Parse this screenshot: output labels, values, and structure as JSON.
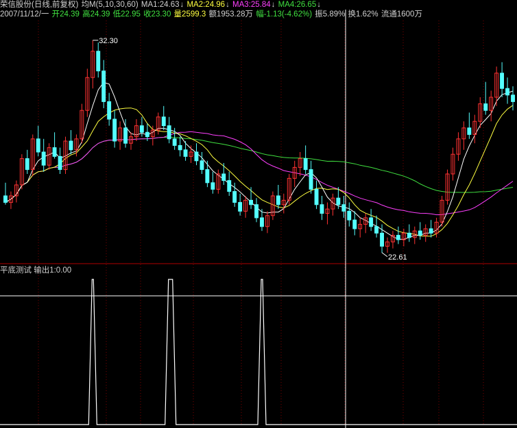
{
  "header": {
    "title": "荣信股份(日线,前复权)",
    "ma_label": "均M(5,10,30,60)",
    "ma1": "MA1:24.63",
    "ma2": "MA2:24.96",
    "ma3": "MA3:25.84",
    "ma4": "MA4:26.65",
    "arrow": "↓"
  },
  "quote": {
    "date": "2007/11/12/一",
    "open": "开24.39",
    "high": "高24.39",
    "low": "低22.95",
    "close": "收23.30",
    "volume": "量2599.3",
    "amount": "额1953.28万",
    "change": "幅-1.13(-4.62%)",
    "amplitude": "振5.89%",
    "turnover": "换1.62%",
    "float": "流通1600万"
  },
  "indicator": {
    "name": "平底测试",
    "output": "输出1:0.00"
  },
  "colors": {
    "up": "#ff3232",
    "down": "#54ffff",
    "ma1": "#ffffff",
    "ma2": "#ffff40",
    "ma3": "#ff40ff",
    "ma4": "#40e040",
    "divider": "#b00000",
    "grid": "#800000"
  },
  "chart_data": {
    "type": "candlestick",
    "price_range": [
      22.2,
      33.2
    ],
    "annotations": [
      {
        "label": "32.30",
        "value": 32.3,
        "kind": "high"
      },
      {
        "label": "22.61",
        "value": 22.61,
        "kind": "low"
      }
    ],
    "candles": [
      [
        25.2,
        25.8,
        24.8,
        24.9
      ],
      [
        24.9,
        25.4,
        24.6,
        25.2
      ],
      [
        25.2,
        25.9,
        24.9,
        25.7
      ],
      [
        25.7,
        27.1,
        25.5,
        26.9
      ],
      [
        26.9,
        27.3,
        26.2,
        26.4
      ],
      [
        26.4,
        28.0,
        26.1,
        27.8
      ],
      [
        27.8,
        28.4,
        27.0,
        27.2
      ],
      [
        27.2,
        27.8,
        26.3,
        26.6
      ],
      [
        26.6,
        27.6,
        26.4,
        27.4
      ],
      [
        27.4,
        28.1,
        26.9,
        27.0
      ],
      [
        27.0,
        27.4,
        26.2,
        26.4
      ],
      [
        26.4,
        27.9,
        26.2,
        27.7
      ],
      [
        27.7,
        28.2,
        27.1,
        27.3
      ],
      [
        27.3,
        28.0,
        27.0,
        27.8
      ],
      [
        27.8,
        29.4,
        27.6,
        29.1
      ],
      [
        29.1,
        31.0,
        28.8,
        30.6
      ],
      [
        30.6,
        32.3,
        30.1,
        31.8
      ],
      [
        31.8,
        32.2,
        30.6,
        30.9
      ],
      [
        30.9,
        31.4,
        29.2,
        29.5
      ],
      [
        29.5,
        29.9,
        28.4,
        28.7
      ],
      [
        28.7,
        29.1,
        27.4,
        27.7
      ],
      [
        27.7,
        28.6,
        27.3,
        28.3
      ],
      [
        28.3,
        28.7,
        27.4,
        27.6
      ],
      [
        27.6,
        28.1,
        27.3,
        27.9
      ],
      [
        27.9,
        28.7,
        27.7,
        28.4
      ],
      [
        28.4,
        28.8,
        27.9,
        28.1
      ],
      [
        28.1,
        28.5,
        27.7,
        27.9
      ],
      [
        27.9,
        28.4,
        27.5,
        28.2
      ],
      [
        28.2,
        29.0,
        28.0,
        28.8
      ],
      [
        28.8,
        29.3,
        28.2,
        28.4
      ],
      [
        28.4,
        28.8,
        27.6,
        27.8
      ],
      [
        27.8,
        28.3,
        27.3,
        27.5
      ],
      [
        27.5,
        27.9,
        27.0,
        27.3
      ],
      [
        27.3,
        27.7,
        26.8,
        27.0
      ],
      [
        27.0,
        27.5,
        26.7,
        27.2
      ],
      [
        27.2,
        27.6,
        26.6,
        26.8
      ],
      [
        26.8,
        27.2,
        26.2,
        26.4
      ],
      [
        26.4,
        26.8,
        25.6,
        25.8
      ],
      [
        25.8,
        26.3,
        25.3,
        25.5
      ],
      [
        25.5,
        26.4,
        25.3,
        26.2
      ],
      [
        26.2,
        26.7,
        25.7,
        25.9
      ],
      [
        25.9,
        26.3,
        25.2,
        25.4
      ],
      [
        25.4,
        25.8,
        24.7,
        24.9
      ],
      [
        24.9,
        25.3,
        24.3,
        24.5
      ],
      [
        24.5,
        25.2,
        24.2,
        25.0
      ],
      [
        25.0,
        25.6,
        24.6,
        24.8
      ],
      [
        24.8,
        25.1,
        24.0,
        24.2
      ],
      [
        24.2,
        24.6,
        23.6,
        23.8
      ],
      [
        23.8,
        24.5,
        23.5,
        24.3
      ],
      [
        24.3,
        25.4,
        24.1,
        25.2
      ],
      [
        25.2,
        25.7,
        24.6,
        24.8
      ],
      [
        24.8,
        25.3,
        24.4,
        25.0
      ],
      [
        25.0,
        26.2,
        24.8,
        26.0
      ],
      [
        26.0,
        26.8,
        25.6,
        26.5
      ],
      [
        26.5,
        27.2,
        26.1,
        26.9
      ],
      [
        26.9,
        27.5,
        26.2,
        26.4
      ],
      [
        26.4,
        26.8,
        25.3,
        25.5
      ],
      [
        25.5,
        25.9,
        24.6,
        24.8
      ],
      [
        24.8,
        25.2,
        24.1,
        24.4
      ],
      [
        24.4,
        24.9,
        23.9,
        24.6
      ],
      [
        24.6,
        25.3,
        24.3,
        25.1
      ],
      [
        25.1,
        25.6,
        24.6,
        24.8
      ],
      [
        24.8,
        25.2,
        24.2,
        24.5
      ],
      [
        24.5,
        24.9,
        23.8,
        24.1
      ],
      [
        24.1,
        24.5,
        23.4,
        23.7
      ],
      [
        23.7,
        24.2,
        23.3,
        23.9
      ],
      [
        23.9,
        24.4,
        23.5,
        24.2
      ],
      [
        24.2,
        24.6,
        23.6,
        23.8
      ],
      [
        23.8,
        24.3,
        23.3,
        23.5
      ],
      [
        23.5,
        23.9,
        22.6,
        22.9
      ],
      [
        22.9,
        23.3,
        22.6,
        23.1
      ],
      [
        23.1,
        23.6,
        22.8,
        23.4
      ],
      [
        23.4,
        23.8,
        23.0,
        23.2
      ],
      [
        23.2,
        23.7,
        22.9,
        23.5
      ],
      [
        23.5,
        23.9,
        23.1,
        23.3
      ],
      [
        23.3,
        23.8,
        23.0,
        23.6
      ],
      [
        23.6,
        24.0,
        23.2,
        23.4
      ],
      [
        23.4,
        23.9,
        23.1,
        23.7
      ],
      [
        23.7,
        24.1,
        23.3,
        23.5
      ],
      [
        23.5,
        24.2,
        23.3,
        24.0
      ],
      [
        24.0,
        25.2,
        23.8,
        25.0
      ],
      [
        25.0,
        26.4,
        24.8,
        26.2
      ],
      [
        26.2,
        27.4,
        25.9,
        27.1
      ],
      [
        27.1,
        28.1,
        26.8,
        27.8
      ],
      [
        27.8,
        28.6,
        27.3,
        28.3
      ],
      [
        28.3,
        29.0,
        27.8,
        28.0
      ],
      [
        28.0,
        28.9,
        27.6,
        28.6
      ],
      [
        28.6,
        29.7,
        28.3,
        29.4
      ],
      [
        29.4,
        30.4,
        28.9,
        29.1
      ],
      [
        29.1,
        30.0,
        28.6,
        29.7
      ],
      [
        29.7,
        31.1,
        29.3,
        30.8
      ],
      [
        30.8,
        31.3,
        29.7,
        30.1
      ],
      [
        30.1,
        30.6,
        29.4,
        29.8
      ],
      [
        29.8,
        30.2,
        29.1,
        29.5
      ]
    ],
    "indicator_peaks": [
      {
        "index": 16,
        "label": "peak-1"
      },
      {
        "index": 30,
        "label": "peak-2"
      },
      {
        "index": 47,
        "label": "peak-3"
      }
    ]
  }
}
